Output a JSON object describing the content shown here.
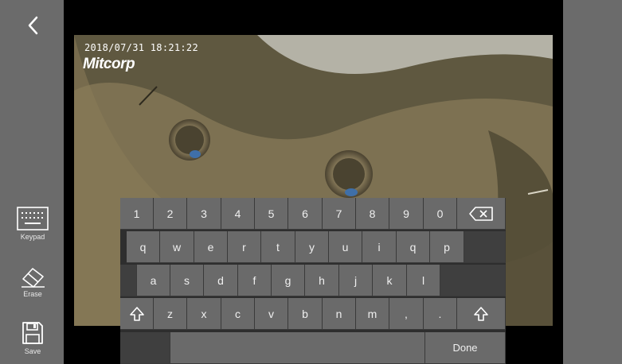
{
  "sidebar": {
    "back_icon": "chevron-left-icon",
    "tools": [
      {
        "label": "Keypad",
        "icon": "keypad-icon"
      },
      {
        "label": "Erase",
        "icon": "eraser-icon"
      },
      {
        "label": "Save",
        "icon": "floppy-disk-icon"
      }
    ]
  },
  "image": {
    "timestamp": "2018/07/31  18:21:22",
    "brand": "Mitcorp"
  },
  "keyboard": {
    "row1": [
      "1",
      "2",
      "3",
      "4",
      "5",
      "6",
      "7",
      "8",
      "9",
      "0"
    ],
    "row2": [
      "q",
      "w",
      "e",
      "r",
      "t",
      "y",
      "u",
      "i",
      "q",
      "p"
    ],
    "row3": [
      "a",
      "s",
      "d",
      "f",
      "g",
      "h",
      "j",
      "k",
      "l"
    ],
    "row4": [
      "z",
      "x",
      "c",
      "v",
      "b",
      "n",
      "m",
      ",",
      "."
    ],
    "backspace_icon": "backspace-icon",
    "shift_icon": "shift-arrow-icon",
    "done_label": "Done"
  },
  "colors": {
    "panel": "#6b6b6b",
    "key": "#6a6a6a",
    "keyboard_bg": "#2e2e2e"
  }
}
